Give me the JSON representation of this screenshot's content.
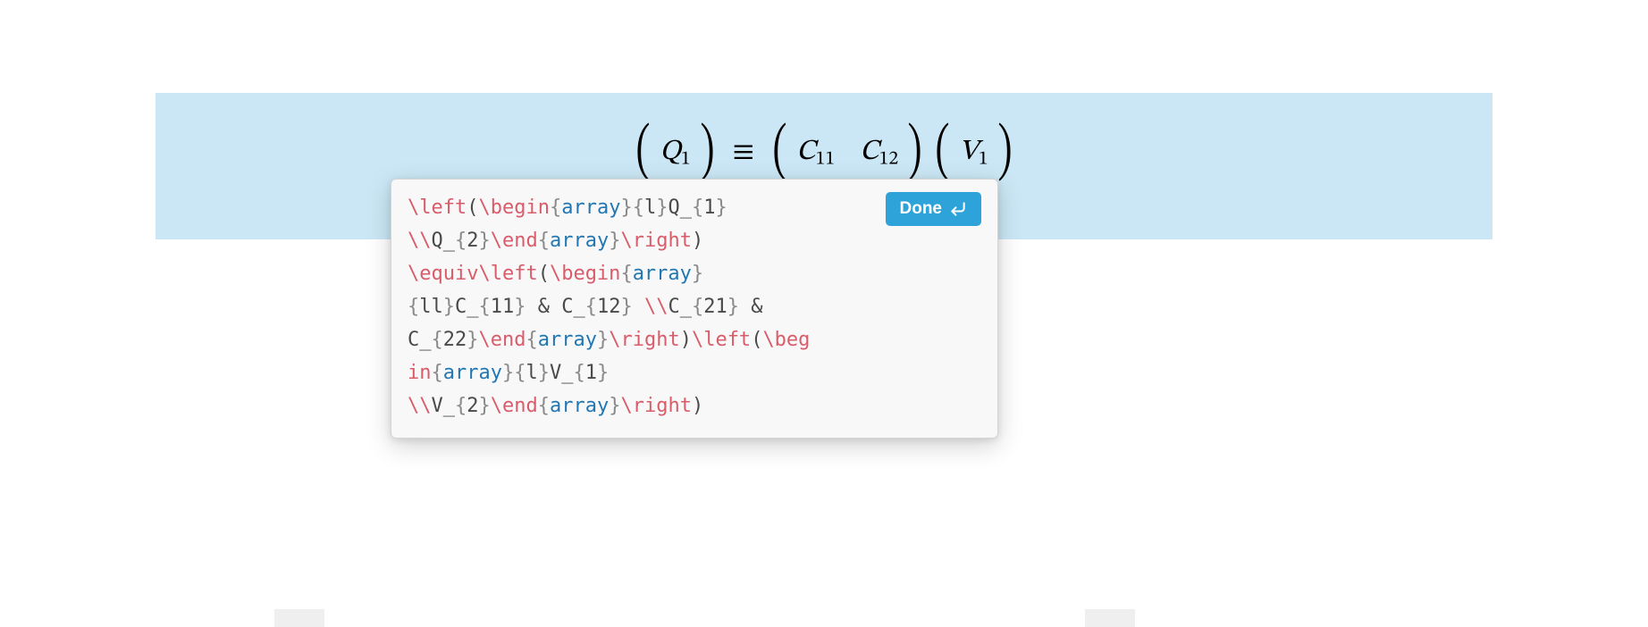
{
  "colors": {
    "highlight": "#cbe7f5",
    "button": "#2ea3d9",
    "token_command": "#d95c6a",
    "token_keyword": "#2277b3",
    "token_brace": "#8a8a8a",
    "text_default": "#4a4a4a"
  },
  "equation": {
    "q1": "Q",
    "q1_sub": "1",
    "c11": "C",
    "c11_sub": "11",
    "c12": "C",
    "c12_sub": "12",
    "v1": "V",
    "v1_sub": "1",
    "equiv": "≡"
  },
  "popover": {
    "done_label": "Done",
    "latex_raw": "\\left(\\begin{array}{l}Q_{1}\\\\Q_{2}\\end{array}\\right)\\equiv\\left(\\begin{array}{ll}C_{11} & C_{12} \\\\C_{21} & C_{22}\\end{array}\\right)\\left(\\begin{array}{l}V_{1}\\\\V_{2}\\end{array}\\right)",
    "latex_lines": [
      [
        {
          "t": "cmd",
          "v": "\\left"
        },
        {
          "t": "txt",
          "v": "("
        },
        {
          "t": "cmd",
          "v": "\\begin"
        },
        {
          "t": "brc",
          "v": "{"
        },
        {
          "t": "kw",
          "v": "array"
        },
        {
          "t": "brc",
          "v": "}{"
        },
        {
          "t": "txt",
          "v": "l"
        },
        {
          "t": "brc",
          "v": "}"
        },
        {
          "t": "txt",
          "v": "Q_"
        },
        {
          "t": "brc",
          "v": "{"
        },
        {
          "t": "txt",
          "v": "1"
        },
        {
          "t": "brc",
          "v": "}"
        }
      ],
      [
        {
          "t": "cmd",
          "v": "\\\\"
        },
        {
          "t": "txt",
          "v": "Q_"
        },
        {
          "t": "brc",
          "v": "{"
        },
        {
          "t": "txt",
          "v": "2"
        },
        {
          "t": "brc",
          "v": "}"
        },
        {
          "t": "cmd",
          "v": "\\end"
        },
        {
          "t": "brc",
          "v": "{"
        },
        {
          "t": "kw",
          "v": "array"
        },
        {
          "t": "brc",
          "v": "}"
        },
        {
          "t": "cmd",
          "v": "\\right"
        },
        {
          "t": "txt",
          "v": ")"
        }
      ],
      [
        {
          "t": "cmd",
          "v": "\\equiv\\left"
        },
        {
          "t": "txt",
          "v": "("
        },
        {
          "t": "cmd",
          "v": "\\begin"
        },
        {
          "t": "brc",
          "v": "{"
        },
        {
          "t": "kw",
          "v": "array"
        },
        {
          "t": "brc",
          "v": "}"
        }
      ],
      [
        {
          "t": "brc",
          "v": "{"
        },
        {
          "t": "txt",
          "v": "ll"
        },
        {
          "t": "brc",
          "v": "}"
        },
        {
          "t": "txt",
          "v": "C_"
        },
        {
          "t": "brc",
          "v": "{"
        },
        {
          "t": "txt",
          "v": "11"
        },
        {
          "t": "brc",
          "v": "}"
        },
        {
          "t": "txt",
          "v": " & C_"
        },
        {
          "t": "brc",
          "v": "{"
        },
        {
          "t": "txt",
          "v": "12"
        },
        {
          "t": "brc",
          "v": "}"
        },
        {
          "t": "txt",
          "v": " "
        },
        {
          "t": "cmd",
          "v": "\\\\"
        },
        {
          "t": "txt",
          "v": "C_"
        },
        {
          "t": "brc",
          "v": "{"
        },
        {
          "t": "txt",
          "v": "21"
        },
        {
          "t": "brc",
          "v": "}"
        },
        {
          "t": "txt",
          "v": " & "
        }
      ],
      [
        {
          "t": "txt",
          "v": "C_"
        },
        {
          "t": "brc",
          "v": "{"
        },
        {
          "t": "txt",
          "v": "22"
        },
        {
          "t": "brc",
          "v": "}"
        },
        {
          "t": "cmd",
          "v": "\\end"
        },
        {
          "t": "brc",
          "v": "{"
        },
        {
          "t": "kw",
          "v": "array"
        },
        {
          "t": "brc",
          "v": "}"
        },
        {
          "t": "cmd",
          "v": "\\right"
        },
        {
          "t": "txt",
          "v": ")"
        },
        {
          "t": "cmd",
          "v": "\\left"
        },
        {
          "t": "txt",
          "v": "("
        },
        {
          "t": "cmd",
          "v": "\\beg"
        }
      ],
      [
        {
          "t": "cmd",
          "v": "in"
        },
        {
          "t": "brc",
          "v": "{"
        },
        {
          "t": "kw",
          "v": "array"
        },
        {
          "t": "brc",
          "v": "}{"
        },
        {
          "t": "txt",
          "v": "l"
        },
        {
          "t": "brc",
          "v": "}"
        },
        {
          "t": "txt",
          "v": "V_"
        },
        {
          "t": "brc",
          "v": "{"
        },
        {
          "t": "txt",
          "v": "1"
        },
        {
          "t": "brc",
          "v": "}"
        }
      ],
      [
        {
          "t": "cmd",
          "v": "\\\\"
        },
        {
          "t": "txt",
          "v": "V_"
        },
        {
          "t": "brc",
          "v": "{"
        },
        {
          "t": "txt",
          "v": "2"
        },
        {
          "t": "brc",
          "v": "}"
        },
        {
          "t": "cmd",
          "v": "\\end"
        },
        {
          "t": "brc",
          "v": "{"
        },
        {
          "t": "kw",
          "v": "array"
        },
        {
          "t": "brc",
          "v": "}"
        },
        {
          "t": "cmd",
          "v": "\\right"
        },
        {
          "t": "txt",
          "v": ")"
        }
      ]
    ]
  }
}
